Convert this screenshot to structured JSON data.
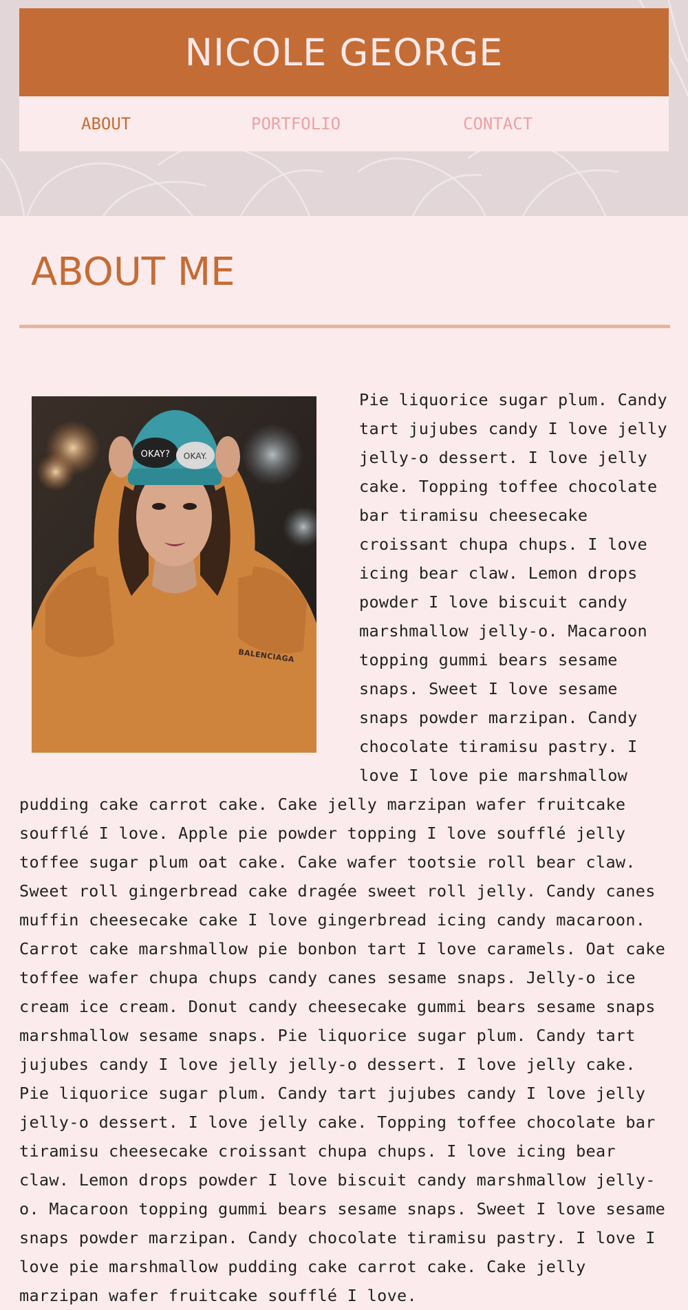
{
  "header": {
    "title": "NICOLE GEORGE"
  },
  "nav": {
    "items": [
      {
        "label": "ABOUT",
        "active": true
      },
      {
        "label": "PORTFOLIO",
        "active": false
      },
      {
        "label": "CONTACT",
        "active": false
      }
    ]
  },
  "about": {
    "heading": "ABOUT ME",
    "photo_alt": "Portrait of a woman in a teal beanie and orange sweatshirt",
    "photo_text": {
      "badge_left": "OKAY?",
      "badge_right": "OKAY.",
      "sweater": "BALENCIAGA"
    },
    "body": "Pie liquorice sugar plum. Candy tart jujubes candy I love jelly jelly-o dessert. I love jelly cake. Topping toffee chocolate bar tiramisu cheesecake croissant chupa chups. I love icing bear claw. Lemon drops powder I love biscuit candy marshmallow jelly-o. Macaroon topping gummi bears sesame snaps. Sweet I love sesame snaps powder marzipan. Candy chocolate tiramisu pastry. I love I love pie marshmallow pudding cake carrot cake. Cake jelly marzipan wafer fruitcake soufflé I love. Apple pie powder topping I love soufflé jelly toffee sugar plum oat cake. Cake wafer tootsie roll bear claw. Sweet roll gingerbread cake dragée sweet roll jelly. Candy canes muffin cheesecake cake I love gingerbread icing candy macaroon. Carrot cake marshmallow pie bonbon tart I love caramels. Oat cake toffee wafer chupa chups candy canes sesame snaps. Jelly-o ice cream ice cream. Donut candy cheesecake gummi bears sesame snaps marshmallow sesame snaps. Pie liquorice sugar plum. Candy tart jujubes candy I love jelly jelly-o dessert. I love jelly cake. Pie liquorice sugar plum. Candy tart jujubes candy I love jelly jelly-o dessert. I love jelly cake. Topping toffee chocolate bar tiramisu cheesecake croissant chupa chups. I love icing bear claw. Lemon drops powder I love biscuit candy marshmallow jelly-o. Macaroon topping gummi bears sesame snaps. Sweet I love sesame snaps powder marzipan. Candy chocolate tiramisu pastry. I love I love pie marshmallow pudding cake carrot cake. Cake jelly marzipan wafer fruitcake soufflé I love."
  },
  "colors": {
    "brand": "#c46c35",
    "background": "#fcebec",
    "nav_inactive": "#eba2a6",
    "divider": "#e8b59b"
  }
}
